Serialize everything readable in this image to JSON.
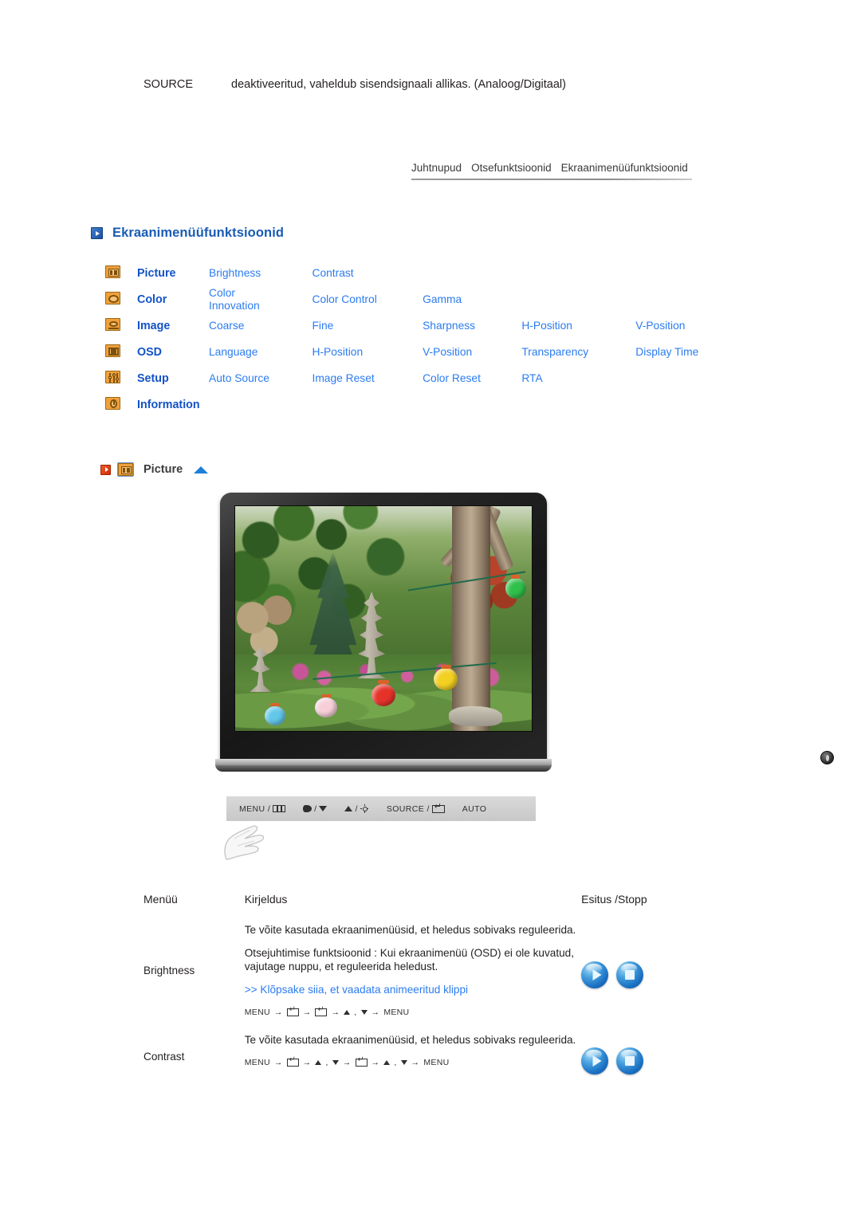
{
  "source_row": {
    "label": "SOURCE",
    "description": "deaktiveeritud, vaheldub sisendsignaali allikas. (Analoog/Digitaal)"
  },
  "tabs": [
    {
      "label": "Juhtnupud"
    },
    {
      "label": "Otsefunktsioonid"
    },
    {
      "label": "Ekraanimenüüfunktsioonid"
    }
  ],
  "page_title": "Ekraanimenüüfunktsioonid",
  "menu_matrix": [
    {
      "icon": "picture-icon",
      "name": "Picture",
      "subs": [
        "Brightness",
        "Contrast"
      ]
    },
    {
      "icon": "color-icon",
      "name": "Color",
      "subs": [
        "Color Innovation",
        "Color Control",
        "Gamma"
      ]
    },
    {
      "icon": "image-icon",
      "name": "Image",
      "subs": [
        "Coarse",
        "Fine",
        "Sharpness",
        "H-Position",
        "V-Position"
      ]
    },
    {
      "icon": "osd-icon",
      "name": "OSD",
      "subs": [
        "Language",
        "H-Position",
        "V-Position",
        "Transparency",
        "Display Time"
      ]
    },
    {
      "icon": "setup-icon",
      "name": "Setup",
      "subs": [
        "Auto Source",
        "Image Reset",
        "Color Reset",
        "RTA"
      ]
    },
    {
      "icon": "info-icon",
      "name": "Information",
      "subs": []
    }
  ],
  "section": {
    "label": "Picture"
  },
  "monitor": {
    "control_bar": [
      {
        "text": "MENU /",
        "glyph": "menu-glyph"
      },
      {
        "text": "/",
        "glyph": "contrast-down-glyph"
      },
      {
        "text": "/",
        "glyph": "up-brightness-glyph"
      },
      {
        "text": "SOURCE /",
        "glyph": "enter-glyph"
      },
      {
        "text": "AUTO",
        "glyph": ""
      }
    ]
  },
  "desc_table": {
    "headers": {
      "menu": "Menüü",
      "description": "Kirjeldus",
      "play_stop": "Esitus /Stopp"
    },
    "rows": [
      {
        "menu": "Brightness",
        "para1": "Te võite kasutada ekraanimenüüsid, et heledus sobivaks reguleerida.",
        "para2": "Otsejuhtimise funktsioonid : Kui ekraanimenüü (OSD) ei ole kuvatud, vajutage nuppu, et reguleerida heledust.",
        "link": ">> Klõpsake siia, et vaadata animeeritud klippi",
        "nav": [
          "MENU",
          "enter",
          "enter",
          "updown",
          "MENU"
        ]
      },
      {
        "menu": "Contrast",
        "para1": "Te võite kasutada ekraanimenüüsid, et heledus sobivaks reguleerida.",
        "para2": "",
        "link": "",
        "nav": [
          "MENU",
          "enter",
          "updown",
          "enter",
          "updown",
          "MENU"
        ]
      }
    ],
    "buttons": {
      "play": "play-button",
      "stop": "stop-button"
    }
  },
  "colors": {
    "link_blue": "#2b7cf0",
    "title_blue": "#1a5cb4",
    "icon_orange": "#f0a03c",
    "text_dark": "#231f20"
  }
}
